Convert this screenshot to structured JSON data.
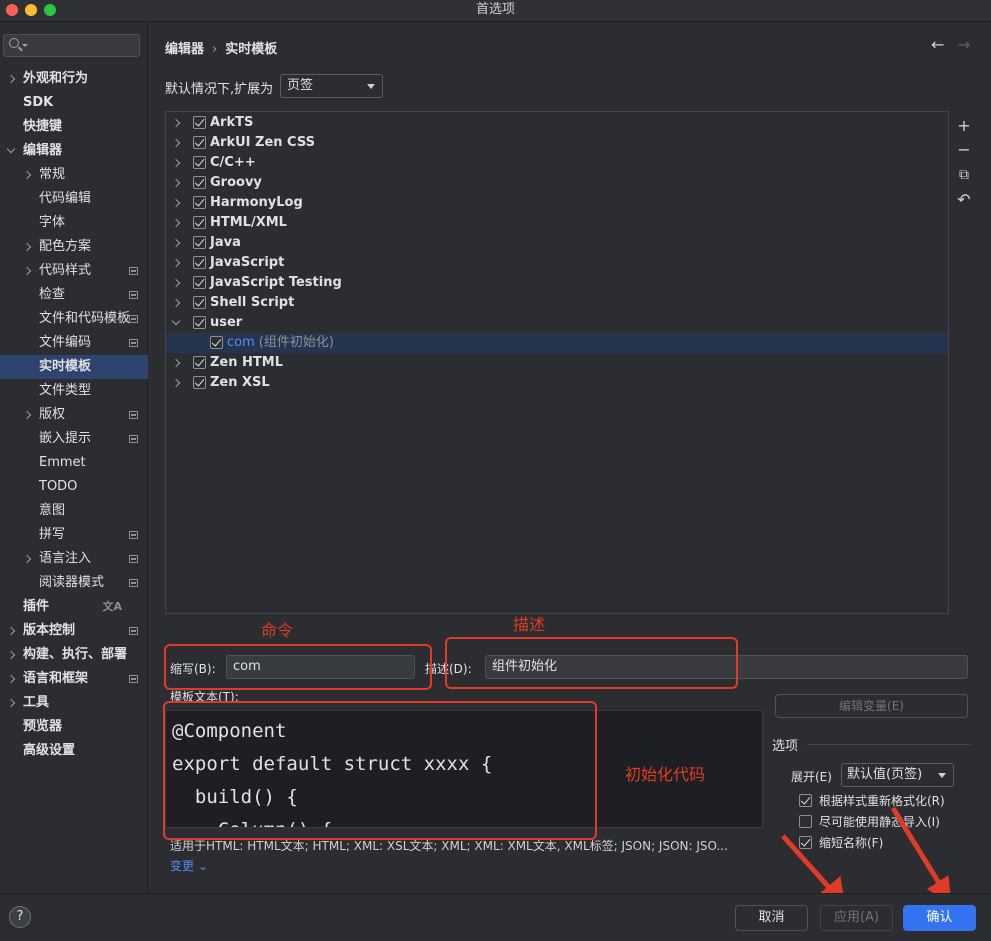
{
  "window": {
    "title": "首选项"
  },
  "sidebar": {
    "search_placeholder": "",
    "items": [
      {
        "label": "外观和行为",
        "bold": true,
        "chevron": "right",
        "indent": 0
      },
      {
        "label": "SDK",
        "bold": true,
        "chevron": "",
        "indent": 0
      },
      {
        "label": "快捷键",
        "bold": true,
        "chevron": "",
        "indent": 0
      },
      {
        "label": "编辑器",
        "bold": true,
        "chevron": "down",
        "indent": 0
      },
      {
        "label": "常规",
        "bold": false,
        "chevron": "right",
        "indent": 1
      },
      {
        "label": "代码编辑",
        "bold": false,
        "chevron": "",
        "indent": 1
      },
      {
        "label": "字体",
        "bold": false,
        "chevron": "",
        "indent": 1
      },
      {
        "label": "配色方案",
        "bold": false,
        "chevron": "right",
        "indent": 1
      },
      {
        "label": "代码样式",
        "bold": false,
        "chevron": "right",
        "indent": 1,
        "proj": true
      },
      {
        "label": "检查",
        "bold": false,
        "chevron": "",
        "indent": 1,
        "proj": true
      },
      {
        "label": "文件和代码模板",
        "bold": false,
        "chevron": "",
        "indent": 1,
        "proj": true
      },
      {
        "label": "文件编码",
        "bold": false,
        "chevron": "",
        "indent": 1,
        "proj": true
      },
      {
        "label": "实时模板",
        "bold": true,
        "chevron": "",
        "indent": 1,
        "selected": true
      },
      {
        "label": "文件类型",
        "bold": false,
        "chevron": "",
        "indent": 1
      },
      {
        "label": "版权",
        "bold": false,
        "chevron": "right",
        "indent": 1,
        "proj": true
      },
      {
        "label": "嵌入提示",
        "bold": false,
        "chevron": "",
        "indent": 1,
        "proj": true
      },
      {
        "label": "Emmet",
        "bold": false,
        "chevron": "",
        "indent": 1
      },
      {
        "label": "TODO",
        "bold": false,
        "chevron": "",
        "indent": 1
      },
      {
        "label": "意图",
        "bold": false,
        "chevron": "",
        "indent": 1
      },
      {
        "label": "拼写",
        "bold": false,
        "chevron": "",
        "indent": 1,
        "proj": true
      },
      {
        "label": "语言注入",
        "bold": false,
        "chevron": "right",
        "indent": 1,
        "proj": true
      },
      {
        "label": "阅读器模式",
        "bold": false,
        "chevron": "",
        "indent": 1,
        "proj": true
      },
      {
        "label": "插件",
        "bold": true,
        "chevron": "",
        "indent": 0,
        "translate": true
      },
      {
        "label": "版本控制",
        "bold": true,
        "chevron": "right",
        "indent": 0,
        "proj": true
      },
      {
        "label": "构建、执行、部署",
        "bold": true,
        "chevron": "right",
        "indent": 0
      },
      {
        "label": "语言和框架",
        "bold": true,
        "chevron": "right",
        "indent": 0,
        "proj": true
      },
      {
        "label": "工具",
        "bold": true,
        "chevron": "right",
        "indent": 0
      },
      {
        "label": "预览器",
        "bold": true,
        "chevron": "",
        "indent": 0
      },
      {
        "label": "高级设置",
        "bold": true,
        "chevron": "",
        "indent": 0
      }
    ]
  },
  "breadcrumb": {
    "parent": "编辑器",
    "separator": "›",
    "current": "实时模板"
  },
  "nav": {
    "back": "←",
    "forward": "→"
  },
  "expand": {
    "label": "默认情况下,扩展为",
    "value": "页签"
  },
  "tree": {
    "groups": [
      {
        "name": "ArkTS",
        "checked": true,
        "expanded": false
      },
      {
        "name": "ArkUI Zen CSS",
        "checked": true,
        "expanded": false
      },
      {
        "name": "C/C++",
        "checked": true,
        "expanded": false
      },
      {
        "name": "Groovy",
        "checked": true,
        "expanded": false
      },
      {
        "name": "HarmonyLog",
        "checked": true,
        "expanded": false
      },
      {
        "name": "HTML/XML",
        "checked": true,
        "expanded": false
      },
      {
        "name": "Java",
        "checked": true,
        "expanded": false
      },
      {
        "name": "JavaScript",
        "checked": true,
        "expanded": false
      },
      {
        "name": "JavaScript Testing",
        "checked": true,
        "expanded": false
      },
      {
        "name": "Shell Script",
        "checked": true,
        "expanded": false
      },
      {
        "name": "user",
        "checked": true,
        "expanded": true
      },
      {
        "name": "com",
        "desc": "(组件初始化)",
        "checked": true,
        "child": true,
        "selected": true
      },
      {
        "name": "Zen HTML",
        "checked": true,
        "expanded": false
      },
      {
        "name": "Zen XSL",
        "checked": true,
        "expanded": false
      }
    ]
  },
  "toolbar": {
    "add": "+",
    "remove": "−",
    "copy": "⧉",
    "restore": "↶"
  },
  "abbreviation": {
    "label": "缩写(B):",
    "value": "com"
  },
  "description": {
    "label": "描述(D):",
    "value": "组件初始化"
  },
  "template_text": {
    "label": "模板文本(T):",
    "lines": [
      "@Component",
      "export default struct xxxx {",
      "  build() {",
      "    Column() {"
    ]
  },
  "edit_variables": "编辑变量(E)",
  "options": {
    "title": "选项",
    "expand_label": "展开(E)",
    "expand_value": "默认值(页签)",
    "reformat": {
      "label": "根据样式重新格式化(R)",
      "checked": true
    },
    "static_import": {
      "label": "尽可能使用静态导入(I)",
      "checked": false
    },
    "shorten_fq": {
      "label": "缩短名称(F)",
      "checked": true
    }
  },
  "applies_to": "适用于HTML: HTML文本; HTML; XML: XSL文本; XML; XML: XML文本, XML标签; JSON; JSON: JSO...",
  "change_link": "变更 ⌄",
  "annotations": {
    "command": "命令",
    "describe": "描述",
    "init_code": "初始化代码",
    "color": "#e03b26"
  },
  "buttons": {
    "help": "?",
    "cancel": "取消",
    "apply": "应用(A)",
    "ok": "确认"
  },
  "colors": {
    "accent": "#3574f0",
    "selection": "#2e436e",
    "link": "#548af7"
  }
}
